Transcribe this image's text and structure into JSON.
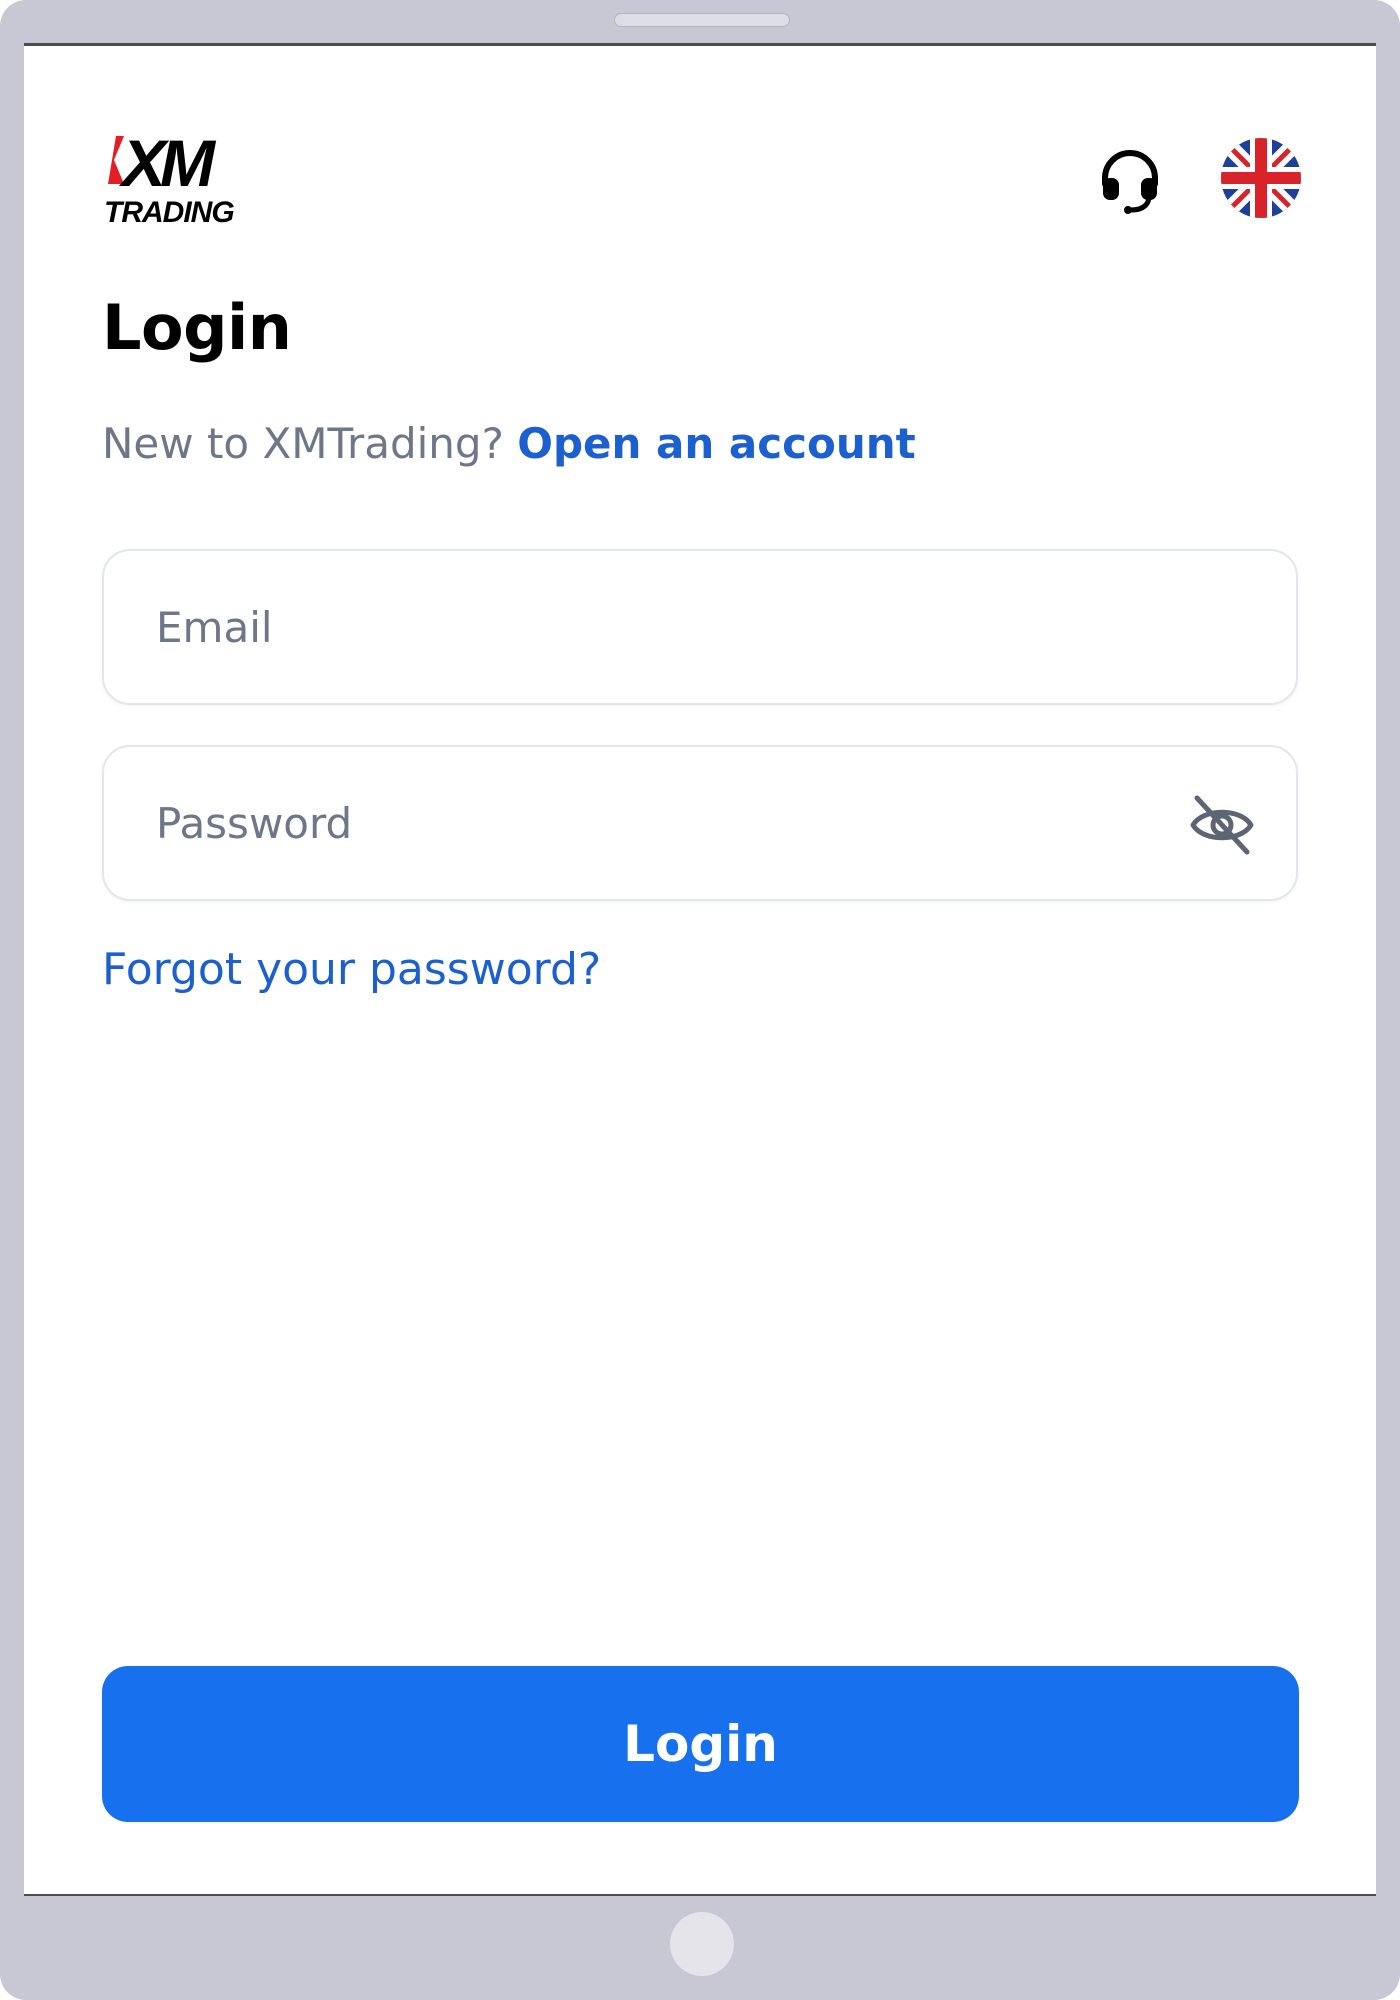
{
  "header": {
    "logo_text": "XM",
    "logo_subtext": "TRADING",
    "support_icon": "headset-icon",
    "language_icon": "uk-flag-icon"
  },
  "page": {
    "title": "Login"
  },
  "signup": {
    "prompt": "New to XMTrading?",
    "link_label": "Open an account"
  },
  "form": {
    "email": {
      "placeholder": "Email",
      "value": ""
    },
    "password": {
      "placeholder": "Password",
      "value": "",
      "visibility_icon": "eye-off-icon"
    }
  },
  "forgot_password_label": "Forgot your password?",
  "submit": {
    "label": "Login"
  },
  "colors": {
    "accent": "#1771ee",
    "link": "#1c5fcf",
    "muted_text": "#6d7787",
    "logo_red": "#e31e24"
  }
}
